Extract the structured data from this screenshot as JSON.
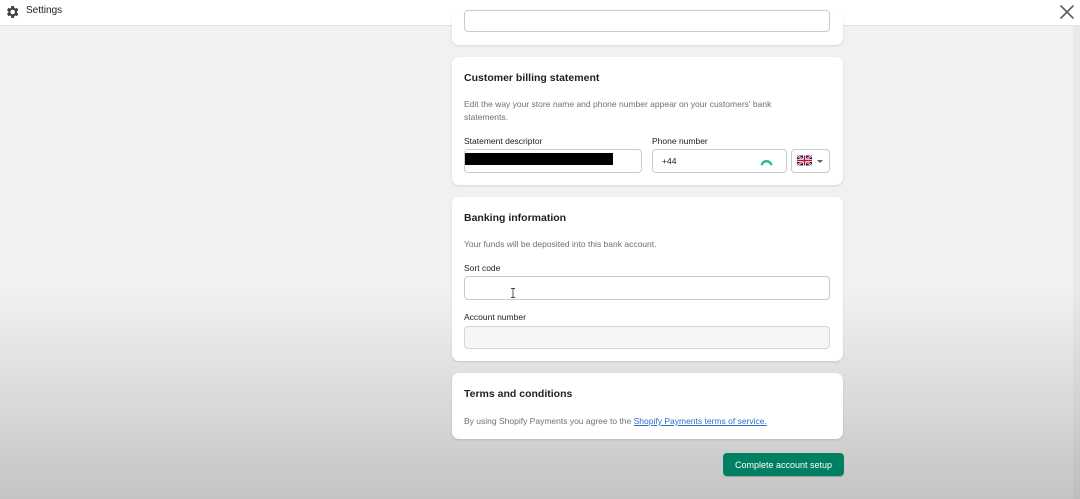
{
  "window": {
    "title": "Settings",
    "icons": {
      "gear": "gear-icon",
      "close": "close-icon"
    }
  },
  "billing": {
    "title": "Customer billing statement",
    "description": "Edit the way your store name and phone number appear on your customers' bank statements.",
    "descriptor_label": "Statement descriptor",
    "phone_label": "Phone number",
    "phone_value": "+44",
    "country_flag": "uk-flag-icon"
  },
  "banking": {
    "title": "Banking information",
    "description": "Your funds will be deposited into this bank account.",
    "sort_code_label": "Sort code",
    "sort_code_value": "",
    "account_number_label": "Account number",
    "account_number_value": ""
  },
  "terms": {
    "title": "Terms and conditions",
    "text": "By using Shopify Payments you agree to the ",
    "link": "Shopify Payments terms of service."
  },
  "actions": {
    "complete_label": "Complete account setup"
  },
  "colors": {
    "primary_button": "#008060",
    "link": "#2c6ecb",
    "accent_arc": "#2bb5a0"
  }
}
